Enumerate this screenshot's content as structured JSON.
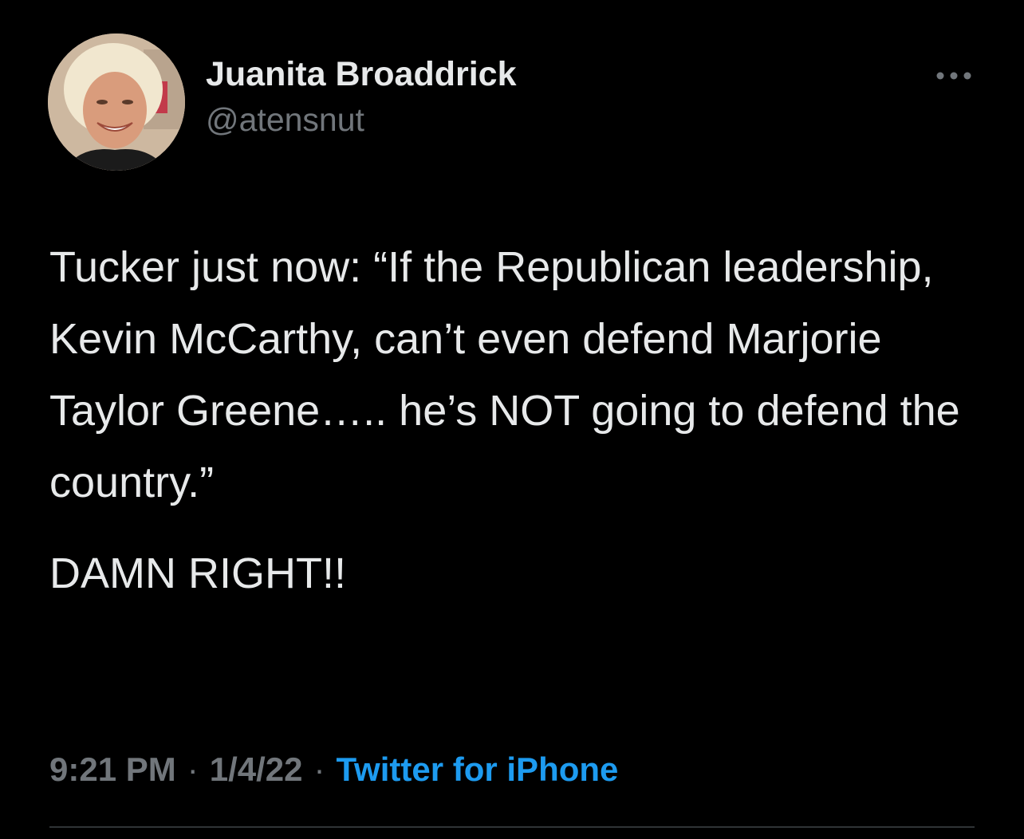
{
  "author": {
    "display_name": "Juanita Broaddrick",
    "handle": "@atensnut",
    "avatar_icon": "avatar-photo"
  },
  "more_icon": "ellipsis-icon",
  "tweet": {
    "paragraphs": [
      "Tucker just now:  “If the Republican leadership, Kevin McCarthy, can’t even defend Marjorie Taylor Greene….. he’s NOT going to defend the country.”",
      "DAMN  RIGHT!!"
    ]
  },
  "meta": {
    "time": "9:21 PM",
    "separator": "·",
    "date": "1/4/22",
    "source": "Twitter for iPhone"
  },
  "colors": {
    "background": "#000000",
    "text": "#e7e9ea",
    "muted": "#71767b",
    "link": "#1d9bf0",
    "divider": "#2f3336"
  }
}
